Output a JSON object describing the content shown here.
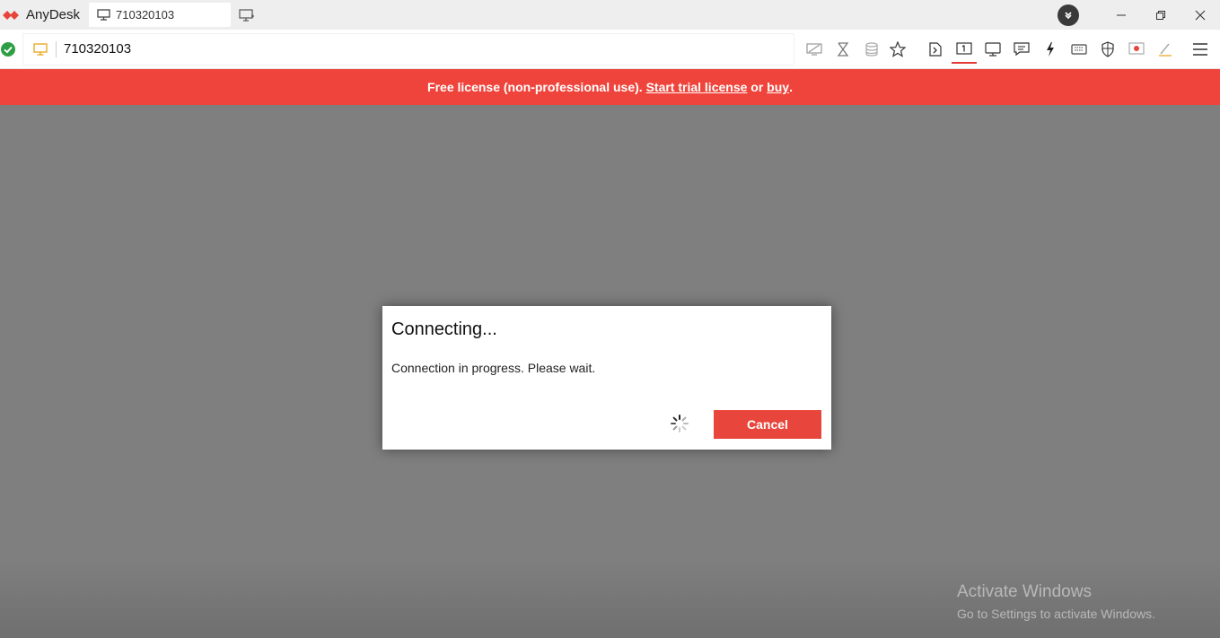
{
  "titlebar": {
    "app_name": "AnyDesk",
    "tab_label": "710320103"
  },
  "toolbar": {
    "address_value": "710320103"
  },
  "banner": {
    "prefix": "Free license (non-professional use). ",
    "trial_link": "Start trial license",
    "middle": " or ",
    "buy_link": "buy",
    "suffix": "."
  },
  "dialog": {
    "title": "Connecting...",
    "message": "Connection in progress. Please wait.",
    "cancel_label": "Cancel"
  },
  "watermark": {
    "title": "Activate Windows",
    "subtitle": "Go to Settings to activate Windows."
  },
  "colors": {
    "accent": "#ef443b",
    "status_ok": "#2e9e44",
    "monitor_icon": "#e8a317"
  }
}
